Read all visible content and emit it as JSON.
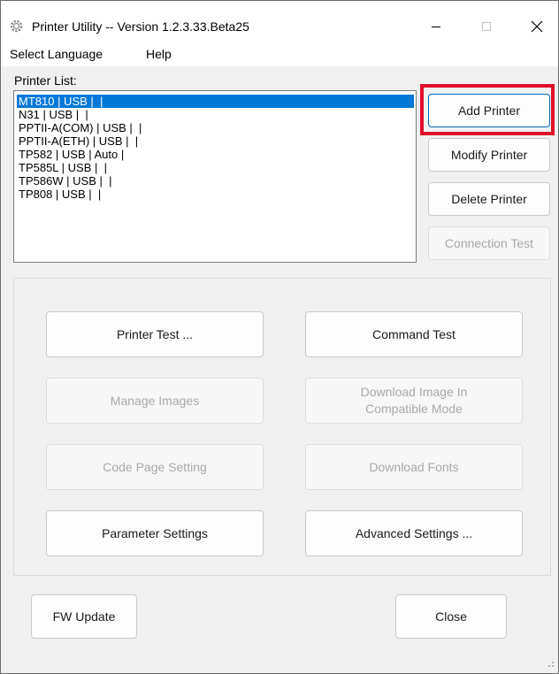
{
  "window": {
    "title": "Printer Utility -- Version 1.2.3.33.Beta25"
  },
  "menu": {
    "select_language": "Select Language",
    "help": "Help"
  },
  "printer_list": {
    "label": "Printer List:",
    "items": [
      "MT810 | USB |  |",
      "N31 | USB |  |",
      "PPTII-A(COM) | USB |  |",
      "PPTII-A(ETH) | USB |  |",
      "TP582 | USB | Auto |",
      "TP585L | USB |  |",
      "TP586W | USB |  |",
      "TP808 | USB |  |"
    ],
    "selected_index": 0
  },
  "side_buttons": {
    "add_printer": "Add Printer",
    "modify_printer": "Modify Printer",
    "delete_printer": "Delete Printer",
    "connection_test": "Connection Test"
  },
  "main_buttons": {
    "printer_test": "Printer Test ...",
    "command_test": "Command Test",
    "manage_images": "Manage Images",
    "download_image_line1": "Download Image In",
    "download_image_line2": "Compatible Mode",
    "code_page_setting": "Code Page Setting",
    "download_fonts": "Download Fonts",
    "parameter_settings": "Parameter Settings",
    "advanced_settings": "Advanced Settings ..."
  },
  "bottom_buttons": {
    "fw_update": "FW Update",
    "close": "Close"
  },
  "colors": {
    "selection": "#0078d7",
    "highlight_box": "#e0102a",
    "disabled_text": "#a8a8a8"
  }
}
